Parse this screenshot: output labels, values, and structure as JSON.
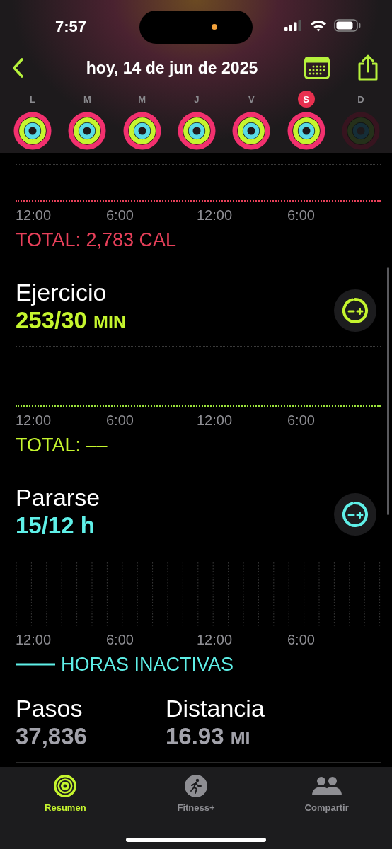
{
  "status_bar": {
    "time": "7:57"
  },
  "nav": {
    "title": "hoy, 14 de jun de 2025"
  },
  "week": [
    {
      "day": "L",
      "selected": false,
      "future": false
    },
    {
      "day": "M",
      "selected": false,
      "future": false
    },
    {
      "day": "M",
      "selected": false,
      "future": false
    },
    {
      "day": "J",
      "selected": false,
      "future": false
    },
    {
      "day": "V",
      "selected": false,
      "future": false
    },
    {
      "day": "S",
      "selected": true,
      "future": false
    },
    {
      "day": "D",
      "selected": false,
      "future": true
    }
  ],
  "move": {
    "axis": [
      "12:00",
      "6:00",
      "12:00",
      "6:00"
    ],
    "total": "TOTAL: 2,783 CAL"
  },
  "exercise": {
    "title": "Ejercicio",
    "value": "253/30",
    "unit": "MIN",
    "axis": [
      "12:00",
      "6:00",
      "12:00",
      "6:00"
    ],
    "total": "TOTAL: ––"
  },
  "stand": {
    "title": "Pararse",
    "value": "15/12 h",
    "axis": [
      "12:00",
      "6:00",
      "12:00",
      "6:00"
    ],
    "legend": "HORAS INACTIVAS"
  },
  "stats": [
    {
      "label": "Pasos",
      "value": "37,836"
    },
    {
      "label": "Distancia",
      "value": "16.93",
      "unit": "MI"
    }
  ],
  "tab_bar": [
    {
      "kind": "rings",
      "label": "Resumen",
      "selected": true
    },
    {
      "kind": "runner",
      "label": "Fitness+",
      "selected": false
    },
    {
      "kind": "people",
      "label": "Compartir",
      "selected": false
    }
  ]
}
